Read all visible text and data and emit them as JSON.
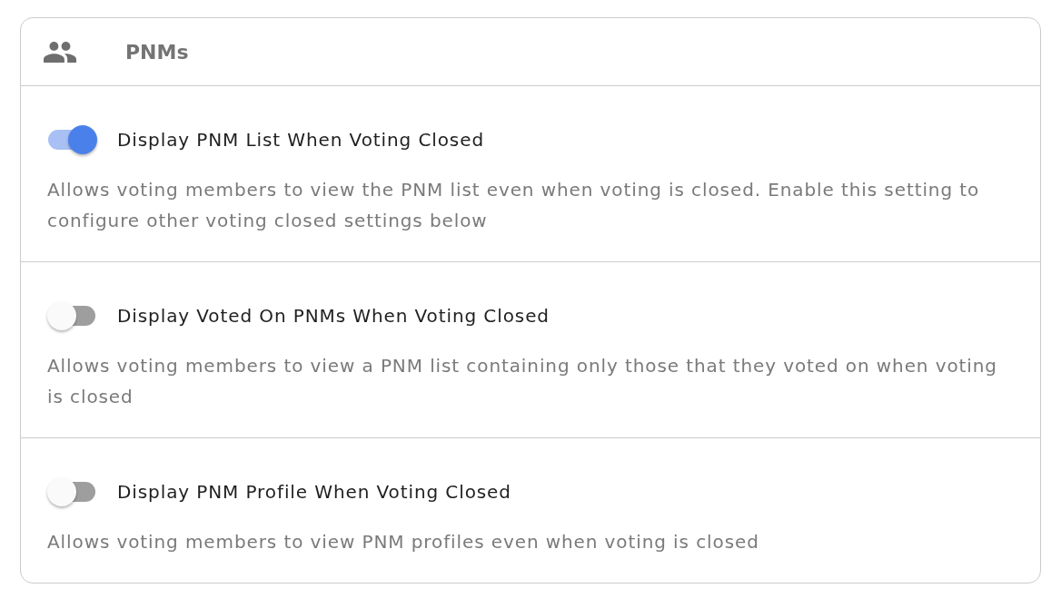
{
  "header": {
    "title": "PNMs"
  },
  "settings": [
    {
      "label": "Display PNM List When Voting Closed",
      "description": "Allows voting members to view the PNM list even when voting is closed. Enable this setting to configure other voting closed settings below",
      "on": true
    },
    {
      "label": "Display Voted On PNMs When Voting Closed",
      "description": "Allows voting members to view a PNM list containing only those that they voted on when voting is closed",
      "on": false
    },
    {
      "label": "Display PNM Profile When Voting Closed",
      "description": "Allows voting members to view PNM profiles even when voting is closed",
      "on": false
    }
  ]
}
